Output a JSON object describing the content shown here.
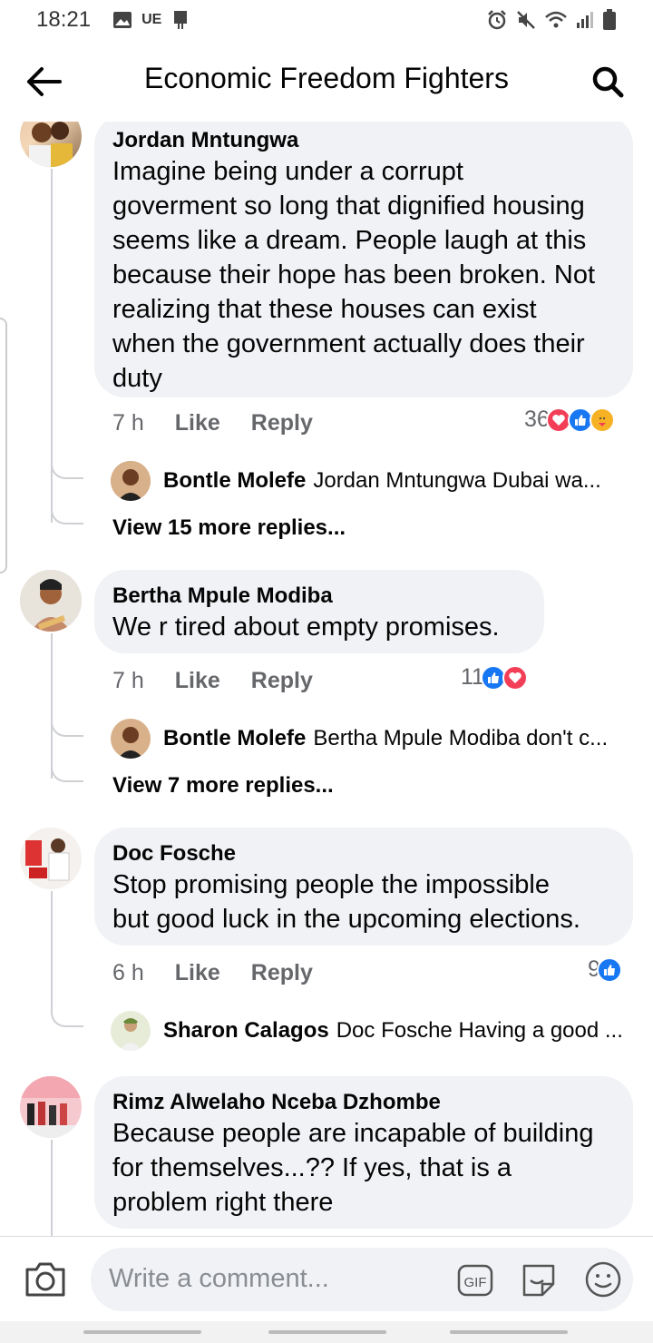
{
  "status_bar": {
    "time": "18:21",
    "carrier_label": "UE"
  },
  "header": {
    "title": "Economic Freedom Fighters"
  },
  "comments": [
    {
      "author": "Jordan Mntungwa",
      "text_lines": [
        "Imagine being under a corrupt",
        "goverment so long that dignified housing",
        "seems like a dream. People laugh at this",
        "because their hope has been broken. Not",
        "realizing that these houses can exist",
        "when the government actually does their",
        "duty"
      ],
      "time": "7 h",
      "like_label": "Like",
      "reply_label": "Reply",
      "reaction_count": "36",
      "reply_preview": {
        "name": "Bontle Molefe",
        "text": "Jordan Mntungwa Dubai wa..."
      },
      "more_replies": "View 15 more replies..."
    },
    {
      "author": "Bertha Mpule Modiba",
      "text_lines": [
        "We r tired about empty promises."
      ],
      "time": "7 h",
      "like_label": "Like",
      "reply_label": "Reply",
      "reaction_count": "11",
      "reply_preview": {
        "name": "Bontle Molefe",
        "text": "Bertha Mpule Modiba don't c..."
      },
      "more_replies": "View 7 more replies..."
    },
    {
      "author": "Doc Fosche",
      "text_lines": [
        "Stop promising people the impossible",
        "but good luck in the upcoming elections."
      ],
      "time": "6 h",
      "like_label": "Like",
      "reply_label": "Reply",
      "reaction_count": "9",
      "reply_preview": {
        "name": "Sharon Calagos",
        "text": "Doc Fosche Having a good ..."
      }
    },
    {
      "author": "Rimz Alwelaho Nceba Dzhombe",
      "text_lines": [
        "Because people are incapable of building",
        "for themselves...?? If yes, that is a",
        "problem right there"
      ]
    }
  ],
  "composer": {
    "placeholder": "Write a comment...",
    "gif_label": "GIF"
  },
  "colors": {
    "bubble": "#f0f2f5",
    "like_blue": "#1877f2",
    "love_red": "#f33e58",
    "care_yellow": "#f7b125",
    "meta_gray": "#65676b"
  }
}
